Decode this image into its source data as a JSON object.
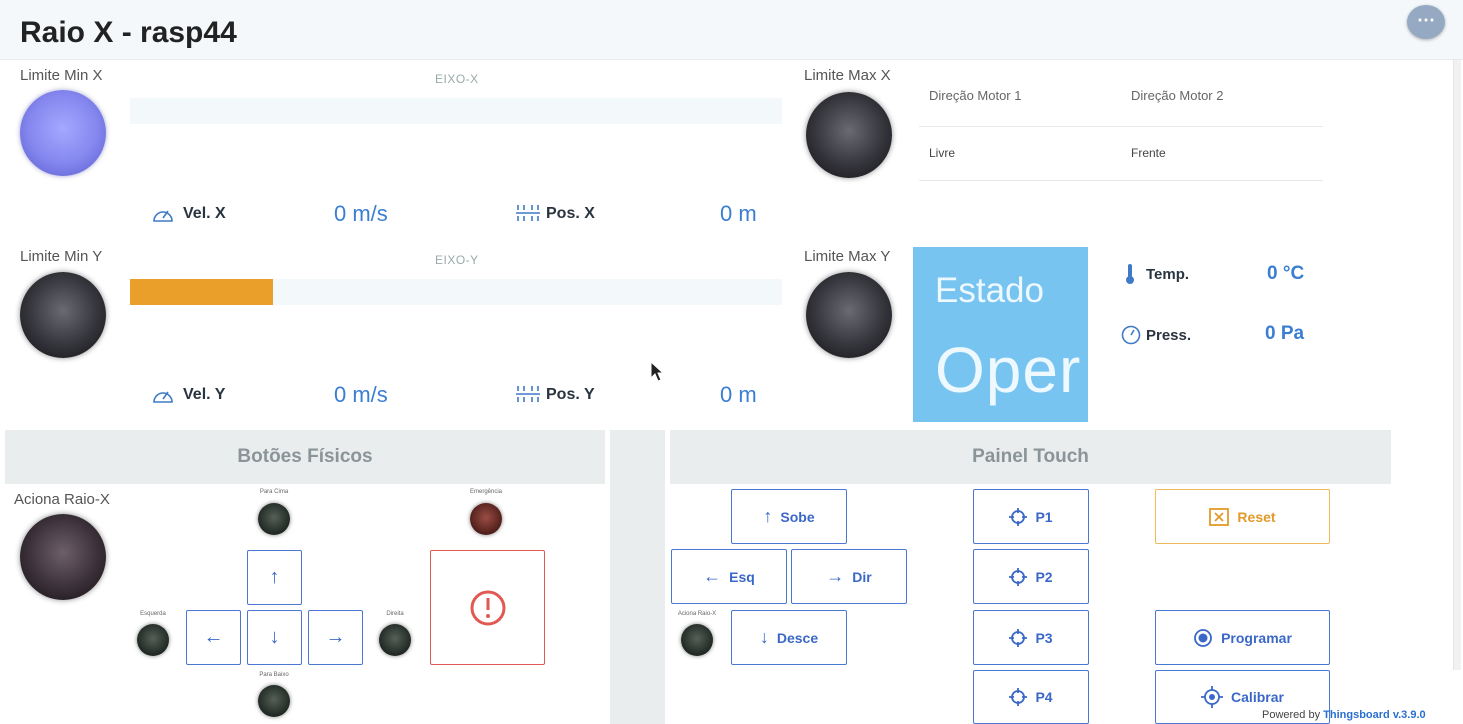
{
  "header": {
    "title": "Raio X - rasp44",
    "more_icon": "⋯"
  },
  "axis_x": {
    "limit_min_label": "Limite Min X",
    "limit_max_label": "Limite Max X",
    "bar_title": "EIXO-X",
    "bar_fill_fraction": 0,
    "vel_label": "Vel. X",
    "vel_value": "0 m/s",
    "pos_label": "Pos. X",
    "pos_value": "0 m"
  },
  "axis_y": {
    "limit_min_label": "Limite Min Y",
    "limit_max_label": "Limite Max Y",
    "bar_title": "EIXO-Y",
    "bar_fill_fraction": 0.22,
    "vel_label": "Vel. Y",
    "vel_value": "0 m/s",
    "pos_label": "Pos. Y",
    "pos_value": "0 m"
  },
  "motors": {
    "headers": [
      "Direção Motor 1",
      "Direção Motor 2"
    ],
    "values": [
      "Livre",
      "Frente"
    ]
  },
  "estado": {
    "label": "Estado",
    "value": "Oper",
    "color": "#78c4f0"
  },
  "sensors": {
    "temp_label": "Temp.",
    "temp_value": "0 °C",
    "press_label": "Press.",
    "press_value": "0 Pa"
  },
  "physical": {
    "title": "Botões Físicos",
    "aciona_label": "Aciona Raio-X",
    "para_cima": "Para Cima",
    "emergencia": "Emergência",
    "esquerda": "Esquerda",
    "direita": "Direita",
    "para_baixo": "Para Baixo",
    "arrow_up": "↑",
    "arrow_left": "←",
    "arrow_down": "↓",
    "arrow_right": "→"
  },
  "touch": {
    "title": "Painel Touch",
    "sobe": "Sobe",
    "esq": "Esq",
    "dir": "Dir",
    "desce": "Desce",
    "aciona_small": "Aciona Raio-X",
    "p1": "P1",
    "p2": "P2",
    "p3": "P3",
    "p4": "P4",
    "reset": "Reset",
    "programar": "Programar",
    "calibrar": "Calibrar"
  },
  "footer": {
    "powered_by": "Powered by",
    "brand": "Thingsboard v.3.9.0"
  },
  "colors": {
    "accent": "#3b68c8",
    "bar_fill": "#e99f2a",
    "led_on": "#8486ee",
    "emergency": "#e05a55",
    "reset": "#e39a2a"
  }
}
